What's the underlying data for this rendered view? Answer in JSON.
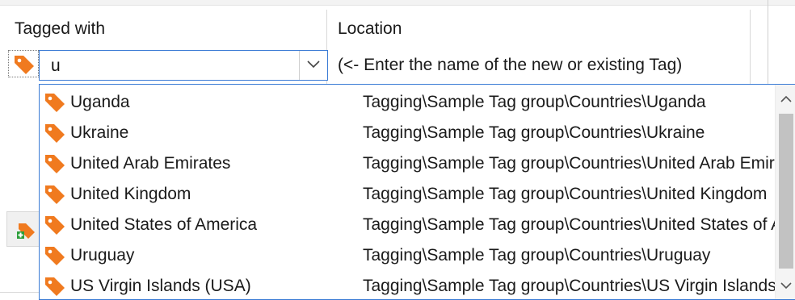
{
  "header": {
    "col1": "Tagged with",
    "col2": "Location"
  },
  "combo": {
    "value": "u",
    "hint": "(<- Enter the name of the new or existing Tag)"
  },
  "dropdown": {
    "items": [
      {
        "name": "Uganda",
        "path": "Tagging\\Sample Tag group\\Countries\\Uganda"
      },
      {
        "name": "Ukraine",
        "path": "Tagging\\Sample Tag group\\Countries\\Ukraine"
      },
      {
        "name": "United Arab Emirates",
        "path": "Tagging\\Sample Tag group\\Countries\\United Arab Emirates"
      },
      {
        "name": "United Kingdom",
        "path": "Tagging\\Sample Tag group\\Countries\\United Kingdom"
      },
      {
        "name": "United States of America",
        "path": "Tagging\\Sample Tag group\\Countries\\United States of America"
      },
      {
        "name": "Uruguay",
        "path": "Tagging\\Sample Tag group\\Countries\\Uruguay"
      },
      {
        "name": "US Virgin Islands (USA)",
        "path": "Tagging\\Sample Tag group\\Countries\\US Virgin Islands (USA)"
      }
    ]
  },
  "icons": {
    "tag": "tag-icon",
    "chevron": "chevron-down-icon",
    "scroll_up": "scroll-up-icon",
    "scroll_down": "scroll-down-icon",
    "add_tag": "add-tag-icon"
  },
  "colors": {
    "tag": "#f07a1f",
    "accent": "#3a7bd5"
  }
}
